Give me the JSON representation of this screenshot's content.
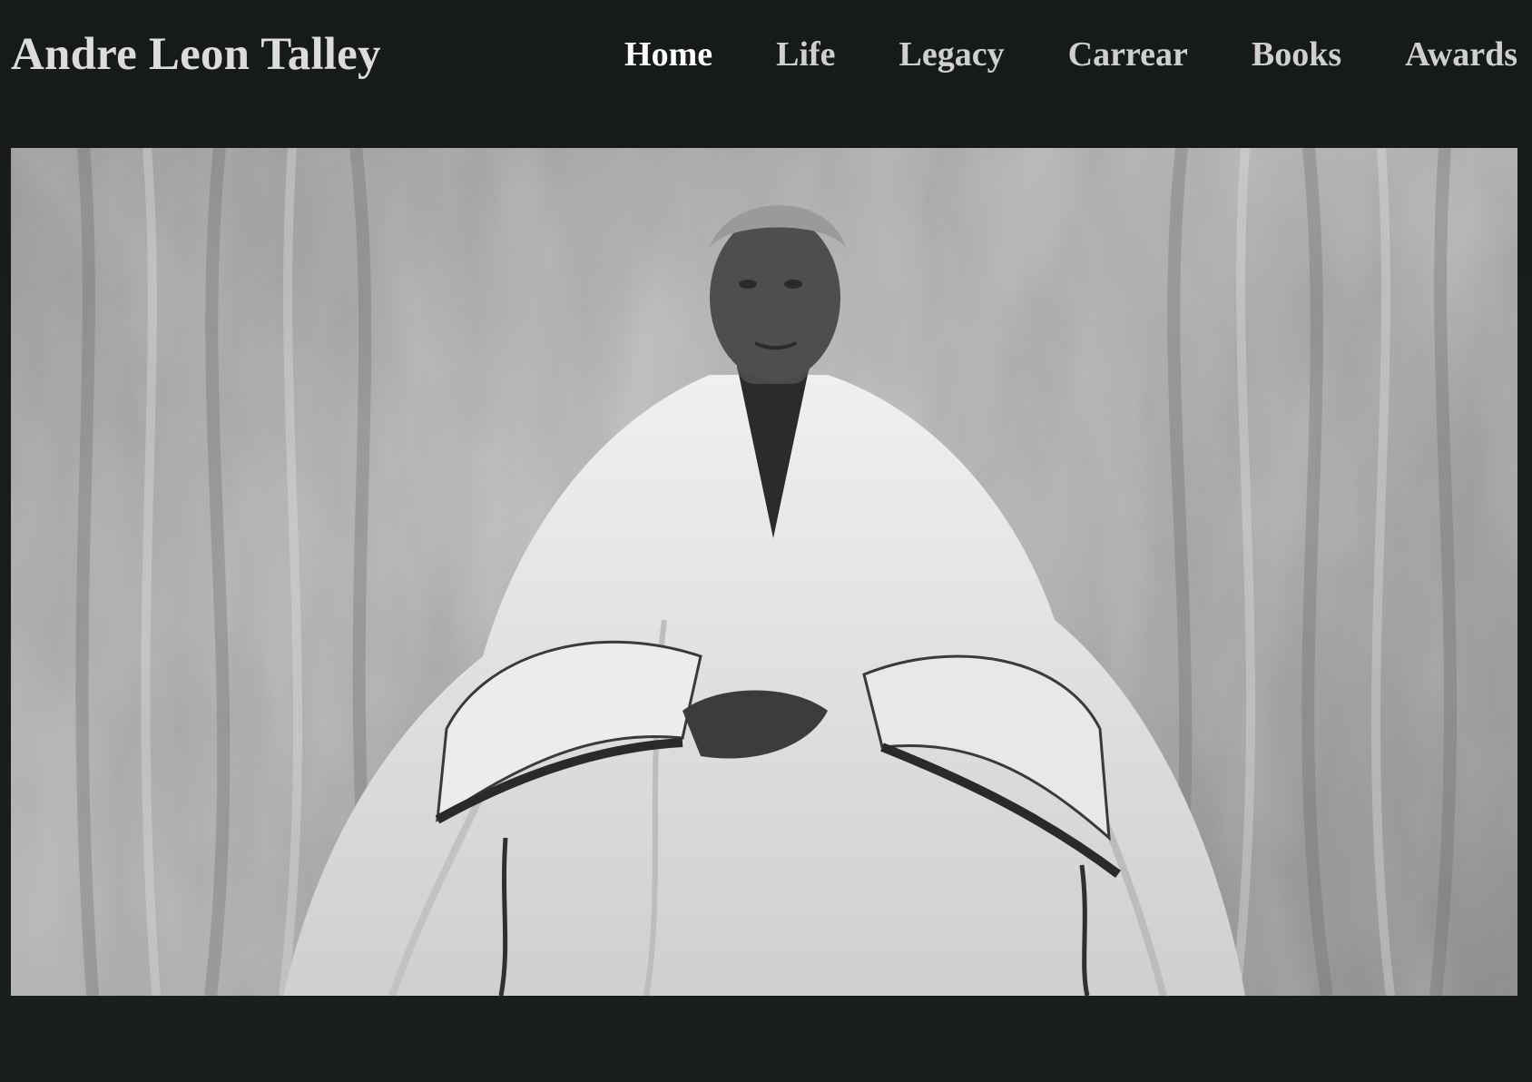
{
  "site": {
    "title": "Andre Leon Talley"
  },
  "nav": {
    "items": [
      {
        "label": "Home",
        "active": true
      },
      {
        "label": "Life",
        "active": false
      },
      {
        "label": "Legacy",
        "active": false
      },
      {
        "label": "Carrear",
        "active": false
      },
      {
        "label": "Books",
        "active": false
      },
      {
        "label": "Awards",
        "active": false
      }
    ]
  },
  "colors": {
    "background": "#181c1c",
    "nav_text": "#cfcfcf",
    "nav_active": "#ffffff",
    "title_text": "#dcdcdc"
  }
}
